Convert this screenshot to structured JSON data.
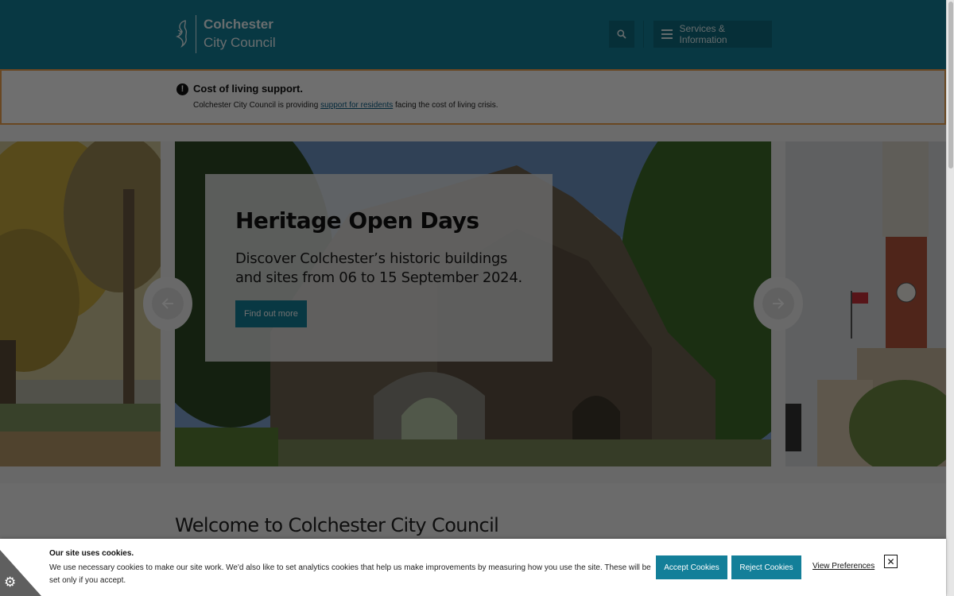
{
  "header": {
    "logo_line1": "Colchester",
    "logo_line2": "City Council",
    "search_icon": "search-icon",
    "menu_label": "Services & Information",
    "menu_icon": "hamburger-icon",
    "bg_color": "#137f99"
  },
  "alert": {
    "icon": "exclamation-circle-icon",
    "title": "Cost of living support.",
    "text_before": "Colchester City Council is providing ",
    "link_text": "support for residents",
    "text_after": " facing the cost of living crisis.",
    "border_color": "#f0a24f"
  },
  "carousel": {
    "slide_title": "Heritage Open Days",
    "slide_text": "Discover Colchester’s historic buildings and sites from 06 to 15 September 2024.",
    "button_label": "Find out more",
    "prev_icon": "arrow-left-icon",
    "next_icon": "arrow-right-icon"
  },
  "main": {
    "welcome_heading": "Welcome to Colchester City Council"
  },
  "cookie_banner": {
    "title": "Our site uses cookies.",
    "text": "We use necessary cookies to make our site work. We'd also like to set analytics cookies that help us make improvements by measuring how you use the site. These will be set only if you accept.",
    "accept_label": "Accept Cookies",
    "reject_label": "Reject Cookies",
    "preferences_label": "View Preferences",
    "close_icon": "close-icon",
    "settings_icon": "gear-icon"
  }
}
